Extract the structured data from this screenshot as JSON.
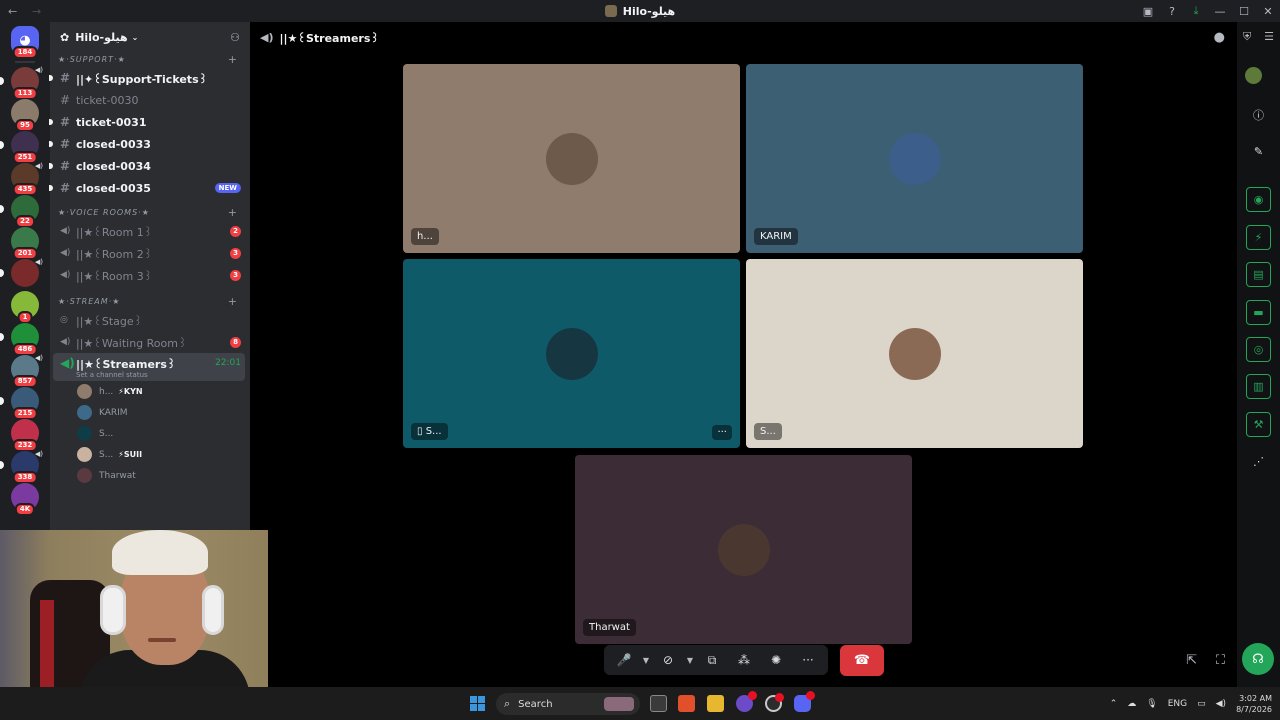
{
  "window": {
    "title": "Hilo-هيلو",
    "buttons": {
      "minimize": "—",
      "maximize": "☐",
      "close": "✕"
    }
  },
  "guild_badges": [
    "184",
    "113",
    "95",
    "251",
    "435",
    "22",
    "201",
    "",
    "1",
    "486",
    "857",
    "215",
    "232",
    "338",
    "4K"
  ],
  "server": {
    "name": "Hilo-هيلو"
  },
  "categories": {
    "support": "★·SUPPORT·★",
    "voice": "★·VOICE ROOMS·★",
    "stream": "★·STREAM·★"
  },
  "text_channels": [
    {
      "name": "||✦꒰Support-Tickets꒱",
      "unread": true
    },
    {
      "name": "ticket-0030",
      "unread": false
    },
    {
      "name": "ticket-0031",
      "unread": true
    },
    {
      "name": "closed-0033",
      "unread": true
    },
    {
      "name": "closed-0034",
      "unread": true
    },
    {
      "name": "closed-0035",
      "unread": true,
      "badge": "NEW"
    }
  ],
  "voice_channels": [
    {
      "name": "||★꒰Room 1꒱",
      "count": "2"
    },
    {
      "name": "||★꒰Room 2꒱",
      "count": "3"
    },
    {
      "name": "||★꒰Room 3꒱",
      "count": "3"
    }
  ],
  "stream_channels": [
    {
      "name": "||★꒰Stage꒱",
      "count": ""
    },
    {
      "name": "||★꒰Waiting Room꒱",
      "count": "8"
    }
  ],
  "active_channel": {
    "name": "||★꒰Streamers꒱",
    "time": "22:01",
    "status": "Set a channel status"
  },
  "voice_users": [
    {
      "name": "h...",
      "tag": "⚡KYN",
      "color": "#8f7c6c"
    },
    {
      "name": "KARIM",
      "tag": "",
      "color": "#3d6a88"
    },
    {
      "name": "S...",
      "tag": "",
      "color": "#0e3c47"
    },
    {
      "name": "S...",
      "tag": "⚡SUII",
      "color": "#c9b3a0"
    },
    {
      "name": "Tharwat",
      "tag": "",
      "color": "#5a3a40"
    }
  ],
  "stage": {
    "header": "||★꒰Streamers꒱",
    "tiles": [
      {
        "label": "h...",
        "bg": "#8f7c6c",
        "avatar": "#6d5a4b",
        "phone": false
      },
      {
        "label": "KARIM",
        "bg": "#3c5f73",
        "avatar": "#3b5e8a",
        "phone": false
      },
      {
        "label": "S...",
        "bg": "#0f5a68",
        "avatar": "#163742",
        "phone": true,
        "more": "···"
      },
      {
        "label": "S...",
        "bg": "#dcd5ca",
        "avatar": "#8b6a55",
        "phone": false
      },
      {
        "label": "Tharwat",
        "bg": "#3b2c36",
        "avatar": "#4a3830",
        "phone": false
      }
    ]
  },
  "controls": {
    "mic": "🎤",
    "camera": "⊘",
    "screenshare": "⧉",
    "activities": "⁂",
    "soundboard": "✺",
    "more": "···",
    "hangup": "☎"
  },
  "taskbar": {
    "search_placeholder": "Search",
    "language": "ENG",
    "time": "3:02 AM",
    "date": "8/7/2026"
  },
  "colors": {
    "blurple": "#5865f2",
    "green": "#23a55a",
    "red": "#da373c"
  }
}
